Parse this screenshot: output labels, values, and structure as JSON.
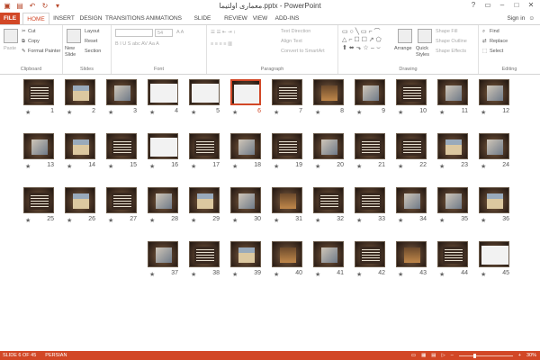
{
  "app": {
    "title": "معماری اولتیما.pptx - PowerPoint",
    "signin": "Sign in"
  },
  "tabs": [
    {
      "label": "FILE"
    },
    {
      "label": "HOME"
    },
    {
      "label": "INSERT"
    },
    {
      "label": "DESIGN"
    },
    {
      "label": "TRANSITIONS"
    },
    {
      "label": "ANIMATIONS"
    },
    {
      "label": "SLIDE SHOW"
    },
    {
      "label": "REVIEW"
    },
    {
      "label": "VIEW"
    },
    {
      "label": "ADD-INS"
    }
  ],
  "ribbon": {
    "clipboard": {
      "paste": "Paste",
      "cut": "Cut",
      "copy": "Copy",
      "format_painter": "Format Painter",
      "label": "Clipboard"
    },
    "slides": {
      "new_slide": "New Slide",
      "layout": "Layout",
      "reset": "Reset",
      "section": "Section",
      "label": "Slides"
    },
    "font": {
      "size": "54",
      "label": "Font"
    },
    "paragraph": {
      "text_direction": "Text Direction",
      "align_text": "Align Text",
      "convert_smartart": "Convert to SmartArt",
      "label": "Paragraph"
    },
    "drawing": {
      "arrange": "Arrange",
      "quick_styles": "Quick Styles",
      "shape_fill": "Shape Fill",
      "shape_outline": "Shape Outline",
      "shape_effects": "Shape Effects",
      "label": "Drawing"
    },
    "editing": {
      "find": "Find",
      "replace": "Replace",
      "select": "Select",
      "label": "Editing"
    }
  },
  "slides": [
    {
      "n": "12",
      "kind": "photo"
    },
    {
      "n": "11",
      "kind": "photo"
    },
    {
      "n": "10",
      "kind": "text"
    },
    {
      "n": "9",
      "kind": "photo"
    },
    {
      "n": "8",
      "kind": "warm"
    },
    {
      "n": "7",
      "kind": "text"
    },
    {
      "n": "6",
      "kind": "white",
      "selected": true
    },
    {
      "n": "5",
      "kind": "white"
    },
    {
      "n": "4",
      "kind": "white"
    },
    {
      "n": "3",
      "kind": "photo"
    },
    {
      "n": "2",
      "kind": "build"
    },
    {
      "n": "1",
      "kind": "text"
    },
    {
      "n": "24",
      "kind": "photo"
    },
    {
      "n": "23",
      "kind": "build"
    },
    {
      "n": "22",
      "kind": "text"
    },
    {
      "n": "21",
      "kind": "text"
    },
    {
      "n": "20",
      "kind": "photo"
    },
    {
      "n": "19",
      "kind": "text"
    },
    {
      "n": "18",
      "kind": "photo"
    },
    {
      "n": "17",
      "kind": "text"
    },
    {
      "n": "16",
      "kind": "white"
    },
    {
      "n": "15",
      "kind": "text"
    },
    {
      "n": "14",
      "kind": "build"
    },
    {
      "n": "13",
      "kind": "photo"
    },
    {
      "n": "36",
      "kind": "build"
    },
    {
      "n": "35",
      "kind": "photo"
    },
    {
      "n": "34",
      "kind": "photo"
    },
    {
      "n": "33",
      "kind": "text"
    },
    {
      "n": "32",
      "kind": "text"
    },
    {
      "n": "31",
      "kind": "warm"
    },
    {
      "n": "30",
      "kind": "photo"
    },
    {
      "n": "29",
      "kind": "build"
    },
    {
      "n": "28",
      "kind": "photo"
    },
    {
      "n": "27",
      "kind": "text"
    },
    {
      "n": "26",
      "kind": "build"
    },
    {
      "n": "25",
      "kind": "text"
    },
    {
      "n": "45",
      "kind": "white"
    },
    {
      "n": "44",
      "kind": "text"
    },
    {
      "n": "43",
      "kind": "warm"
    },
    {
      "n": "42",
      "kind": "text"
    },
    {
      "n": "41",
      "kind": "photo"
    },
    {
      "n": "40",
      "kind": "warm"
    },
    {
      "n": "39",
      "kind": "build"
    },
    {
      "n": "38",
      "kind": "text"
    },
    {
      "n": "37",
      "kind": "photo"
    }
  ],
  "status": {
    "slide_of": "SLIDE 6 OF 45",
    "language": "PERSIAN",
    "zoom": "30%"
  },
  "colors": {
    "accent": "#d24726"
  }
}
